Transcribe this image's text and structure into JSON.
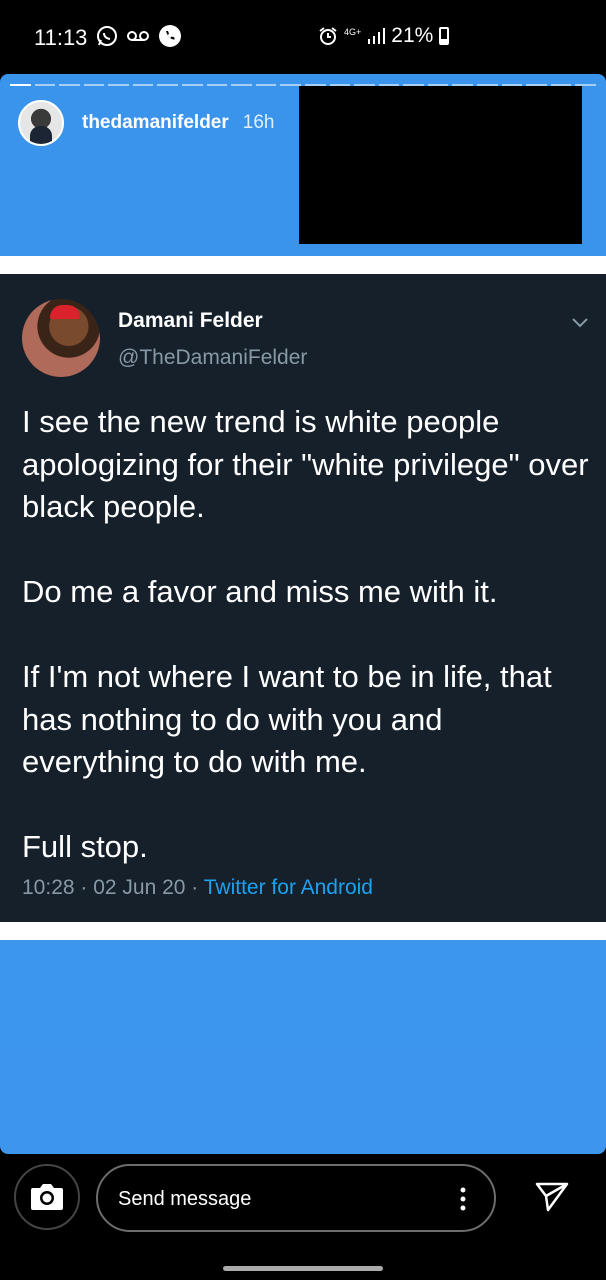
{
  "status_bar": {
    "time": "11:13",
    "network": "4G+",
    "battery": "21%"
  },
  "story": {
    "username": "thedamanifelder",
    "time_ago": "16h"
  },
  "tweet": {
    "name": "Damani Felder",
    "handle": "@TheDamaniFelder",
    "paragraphs": [
      "I see the new trend is white people apologizing for their \"white privilege\" over black people.",
      "Do me a favor and miss me with it.",
      "If I'm not where I want to be in life, that has nothing to do with you and everything to do with me.",
      "Full stop."
    ],
    "timestamp": "10:28 · 02 Jun 20 · ",
    "source": "Twitter for Android"
  },
  "reply": {
    "placeholder": "Send message"
  },
  "colors": {
    "story_blue": "#3a94ec",
    "tweet_bg": "#15202b",
    "handle_gray": "#8899a6",
    "link_blue": "#1da1f2"
  }
}
